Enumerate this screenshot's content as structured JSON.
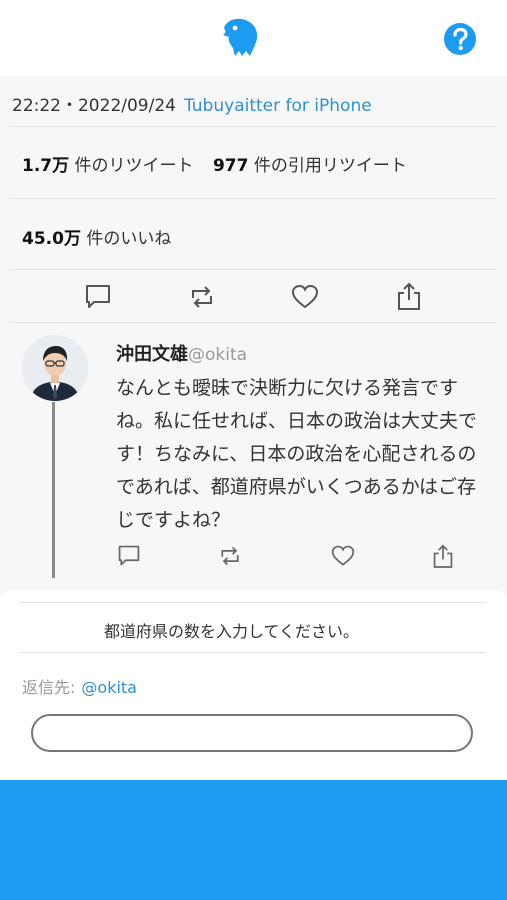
{
  "app": {
    "logo_icon": "eagle-icon",
    "help_icon": "question-circle-icon",
    "accent_color": "#1d9bf0"
  },
  "tweet": {
    "time": "22:22・2022/09/24",
    "via": "Tubuyaitter for iPhone",
    "retweet_count": "1.7万",
    "retweet_label": "件のリツイート",
    "quote_count": "977",
    "quote_label": "件の引用リツイート",
    "like_count": "45.0万",
    "like_label": "件のいいね"
  },
  "reply": {
    "name": "沖田文雄",
    "handle": "@okita",
    "text": "なんとも曖昧で決断力に欠ける発言ですね。私に任せれば、日本の政治は大丈夫です！ちなみに、日本の政治を心配されるのであれば、都道府県がいくつあるかはご存じですよね？"
  },
  "composer": {
    "prompt": "都道府県の数を入力してください。",
    "reply_to_label": "返信先:",
    "reply_to_handle": "@okita",
    "input_value": ""
  }
}
